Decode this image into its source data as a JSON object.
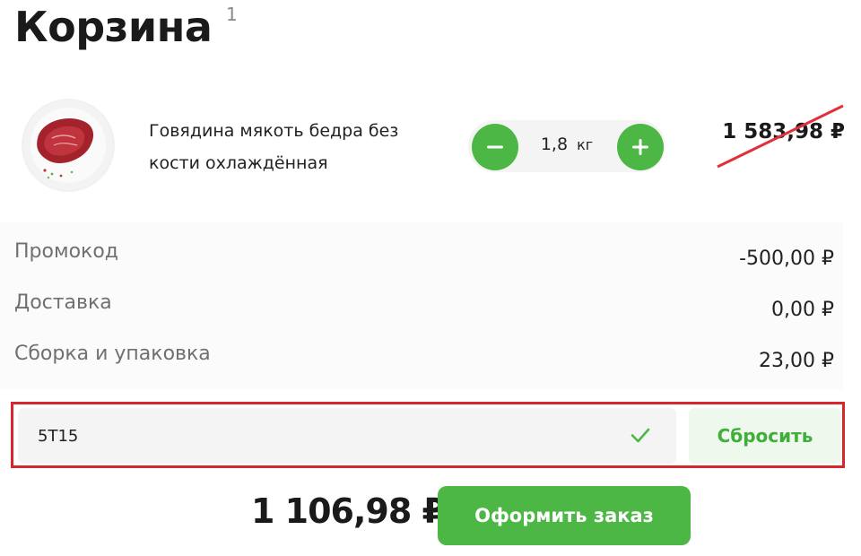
{
  "header": {
    "title": "Корзина",
    "item_count": "1"
  },
  "product": {
    "name": "Говядина мякоть бедра без кости охлаждённая",
    "quantity": "1,8",
    "unit": "кг",
    "old_price": "1 583,98 ₽"
  },
  "summary": {
    "promo_label": "Промокод",
    "promo_value": "-500,00 ₽",
    "delivery_label": "Доставка",
    "delivery_value": "0,00 ₽",
    "packing_label": "Сборка и упаковка",
    "packing_value": "23,00 ₽"
  },
  "promo": {
    "code_value": "5T15",
    "reset_label": "Сбросить"
  },
  "footer": {
    "total": "1 106,98 ₽",
    "checkout_label": "Оформить заказ"
  },
  "colors": {
    "accent": "#4cb744",
    "highlight_frame": "#d7262d",
    "strike_line": "#e0313a"
  }
}
